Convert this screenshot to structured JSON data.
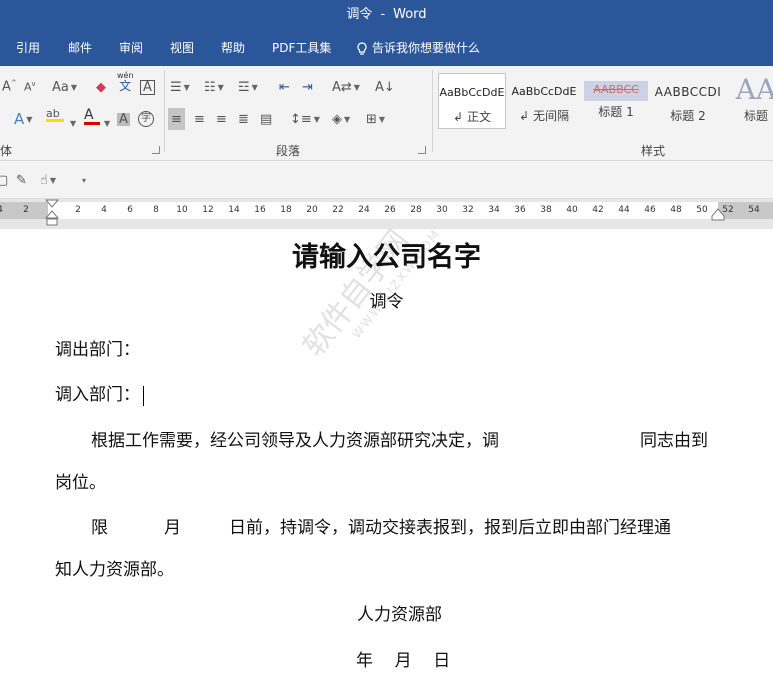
{
  "titlebar": {
    "doc": "调令",
    "sep": "-",
    "app": "Word"
  },
  "tabs": [
    "引用",
    "邮件",
    "审阅",
    "视图",
    "帮助",
    "PDF工具集"
  ],
  "tell_me": "告诉我你想要做什么",
  "ribbon": {
    "font_group_label": "体",
    "paragraph_group_label": "段落",
    "styles_group_label": "样式",
    "font_buttons": {
      "case": "Aa",
      "phonetic_top": "wén",
      "phonetic_bottom": "文",
      "enclose": "字",
      "char_shade": "A",
      "border_a": "A"
    },
    "styles": [
      {
        "sample": "AaBbCcDdE",
        "name": "正文",
        "prefix": "↲"
      },
      {
        "sample": "AaBbCcDdE",
        "name": "无间隔",
        "prefix": "↲"
      },
      {
        "sample": "AABBCC",
        "name": "标题 1",
        "prefix": ""
      },
      {
        "sample": "AABBCCDI",
        "name": "标题 2",
        "prefix": ""
      },
      {
        "sample": "AA",
        "name": "标题",
        "prefix": ""
      }
    ],
    "colors": {
      "highlight": "#f2e200",
      "font_color": "#d40000",
      "accent": "#2b579a"
    }
  },
  "ruler": {
    "ticks": [
      "4",
      "2",
      "",
      "2",
      "4",
      "6",
      "8",
      "10",
      "12",
      "14",
      "16",
      "18",
      "20",
      "22",
      "24",
      "26",
      "28",
      "30",
      "32",
      "34",
      "36",
      "38",
      "40",
      "42",
      "44",
      "46",
      "48",
      "50",
      "52",
      "54"
    ]
  },
  "document": {
    "title": "请输入公司名字",
    "subtitle": "调令",
    "out_dept": "调出部门：",
    "in_dept": "调入部门：",
    "para1_line1_a": "根据工作需要，经公司领导及人力资源部研究决定，调",
    "para1_line1_b": "同志由到",
    "para1_line2": "岗位。",
    "para2_line1_a": "限",
    "para2_line1_b": "月",
    "para2_line1_c": "日前，持调令，调动交接表报到，报到后立即由部门经理通",
    "para2_line2": "知人力资源部。",
    "signature": "人力资源部",
    "date_line": "年    月    日"
  },
  "watermark": {
    "main": "软件自学网",
    "sub": "WWW.RJZXW.COM"
  }
}
